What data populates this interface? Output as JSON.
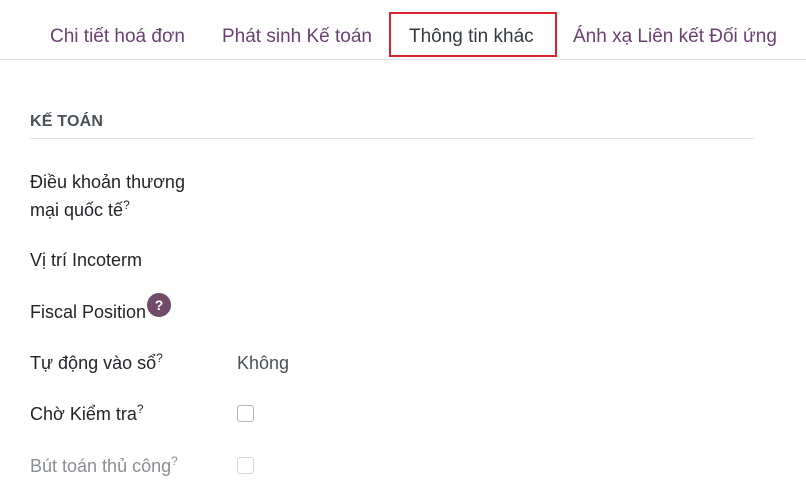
{
  "tabs": [
    {
      "label": "Chi tiết hoá đơn",
      "active": false
    },
    {
      "label": "Phát sinh Kế toán",
      "active": false
    },
    {
      "label": "Thông tin khác",
      "active": true
    },
    {
      "label": "Ánh xạ Liên kết Đối ứng",
      "active": false
    }
  ],
  "section": {
    "title": "KẾ TOÁN"
  },
  "fields": {
    "incoterm": {
      "label_line1": "Điều khoản thương",
      "label_line2": "mại quốc tế",
      "help": "?"
    },
    "incoterm_location": {
      "label": "Vị trí Incoterm"
    },
    "fiscal_position": {
      "label": "Fiscal Position",
      "help": "?"
    },
    "auto_post": {
      "label": "Tự động vào sổ",
      "help": "?",
      "value": "Không"
    },
    "to_check": {
      "label": "Chờ Kiểm tra",
      "help": "?",
      "checked": false
    },
    "manual_entry": {
      "label": "Bút toán thủ công",
      "help": "?",
      "checked": false,
      "disabled": true
    }
  },
  "colors": {
    "tab_text": "#6c3f73",
    "active_outline": "#d9232d",
    "help_bubble": "#714b67"
  }
}
